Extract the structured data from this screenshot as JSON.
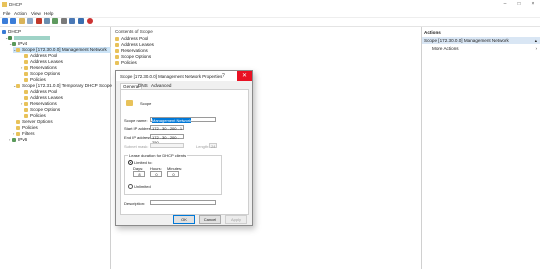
{
  "app": {
    "title": "DHCP"
  },
  "menu": [
    "File",
    "Action",
    "View",
    "Help"
  ],
  "tree": {
    "root": "DHCP",
    "server": "",
    "ipv4": "IPv4",
    "scope1": "Scope [172.30.0.0] Management Network",
    "scope1_children": [
      "Address Pool",
      "Address Leases",
      "Reservations",
      "Scope Options",
      "Policies"
    ],
    "scope2": "Scope [172.31.0.0] Temporary DHCP Scope",
    "scope2_children": [
      "Address Pool",
      "Address Leases",
      "Reservations",
      "Scope Options",
      "Policies"
    ],
    "server_options": "Server Options",
    "policies": "Policies",
    "filters": "Filters",
    "ipv6": "IPv6"
  },
  "content": {
    "header": "Contents of Scope",
    "items": [
      "Address Pool",
      "Address Leases",
      "Reservations",
      "Scope Options",
      "Policies"
    ]
  },
  "actions": {
    "header": "Actions",
    "selected": "Scope [172.30.0.0] Management Network",
    "more": "More Actions"
  },
  "dialog": {
    "title": "Scope [172.30.0.0] Management Network Properties",
    "tabs": [
      "General",
      "DNS",
      "Advanced"
    ],
    "section": "Scope",
    "scope_name_label": "Scope name:",
    "scope_name_value": "Management Network",
    "start_ip_label": "Start IP address:",
    "start_ip": [
      "172",
      "30",
      "200",
      "1"
    ],
    "end_ip_label": "End IP address:",
    "end_ip": [
      "172",
      "30",
      "200",
      "250"
    ],
    "length_label": "Length:",
    "length_value": "24",
    "subnet_label": "Subnet mask:",
    "lease_group": "Lease duration for DHCP clients",
    "limited_label": "Limited to:",
    "days_label": "Days:",
    "hours_label": "Hours:",
    "minutes_label": "Minutes:",
    "days": "8",
    "hours": "0",
    "minutes": "0",
    "unlimited_label": "Unlimited",
    "description_label": "Description:",
    "description_value": "",
    "ok": "OK",
    "cancel": "Cancel",
    "apply": "Apply"
  },
  "colors": {
    "selection": "#cce4f7",
    "close": "#e81123",
    "folder": "#e8c25a"
  }
}
